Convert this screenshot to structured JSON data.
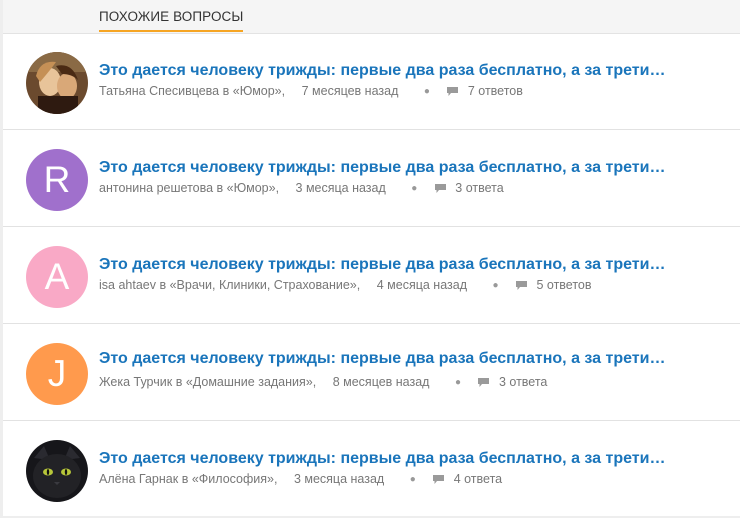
{
  "header": {
    "title": "ПОХОЖИЕ ВОПРОСЫ"
  },
  "questions": [
    {
      "title": "Это дается человеку трижды: первые два раза бесплатно, а за третий раз надо платить",
      "author": "Татьяна Спесивцева",
      "category_prefix": "в",
      "category": "«Юмор»",
      "time": "7 месяцев назад",
      "answers": "7 ответов",
      "avatar": {
        "type": "photo",
        "icon": "user-photo"
      }
    },
    {
      "title": "Это дается человеку трижды: первые два раза бесплатно, а за третий раз надо платить",
      "author": "антонина решетова",
      "category_prefix": "в",
      "category": "«Юмор»",
      "time": "3 месяца назад",
      "answers": "3 ответа",
      "avatar": {
        "type": "letter",
        "letter": "R",
        "color": "#a070cc"
      }
    },
    {
      "title": "Это дается человеку трижды: первые два раза бесплатно, а за третий раз надо платить",
      "author": "isa ahtaev",
      "category_prefix": "в",
      "category": "«Врачи, Клиники, Страхование»",
      "time": "4 месяца назад",
      "answers": "5 ответов",
      "avatar": {
        "type": "letter",
        "letter": "A",
        "color": "#f9a9c6"
      }
    },
    {
      "title": "Это дается человеку трижды: первые два раза бесплатно, а за третий раз надо платить",
      "author": "Жека Турчик",
      "category_prefix": "в",
      "category": "«Домашние задания»",
      "time": "8 месяцев назад",
      "answers": "3 ответа",
      "avatar": {
        "type": "letter",
        "letter": "J",
        "color": "#ff9a4d"
      }
    },
    {
      "title": "Это дается человеку трижды: первые два раза бесплатно, а за третий раз надо платить",
      "author": "Алёна Гарнак",
      "category_prefix": "в",
      "category": "«Философия»",
      "time": "3 месяца назад",
      "answers": "4 ответа",
      "avatar": {
        "type": "photo",
        "icon": "cat-photo"
      }
    }
  ],
  "colors": {
    "link": "#1a75bb",
    "meta": "#777777",
    "accent": "#f6a523"
  }
}
